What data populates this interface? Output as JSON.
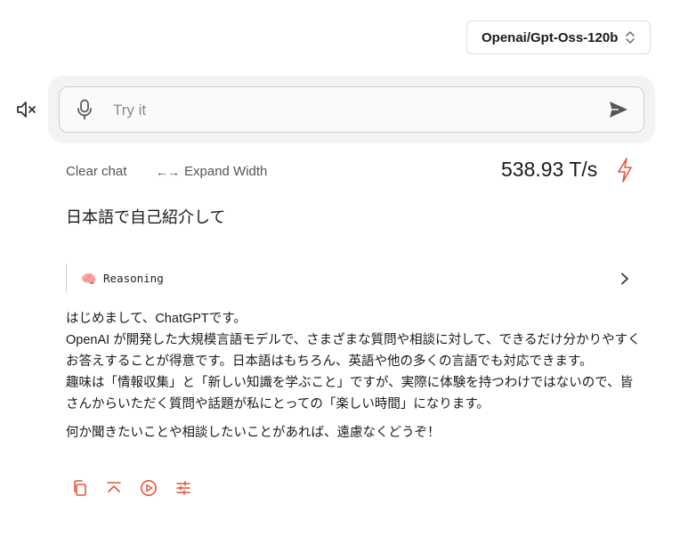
{
  "model_selector": {
    "value": "Openai/Gpt-Oss-120b"
  },
  "input": {
    "placeholder": "Try it",
    "value": ""
  },
  "toolbar": {
    "clear_chat": "Clear chat",
    "expand_width_arrows": "←→",
    "expand_width": "Expand Width",
    "speed": "538.93 T/s"
  },
  "chat": {
    "user_message": "日本語で自己紹介して",
    "reasoning_label": "Reasoning",
    "reasoning_emoji": "🧠",
    "answer_lines": [
      "はじめまして、ChatGPTです。",
      "OpenAI が開発した大規模言語モデルで、さまざまな質問や相談に対して、できるだけ分かりやすく",
      "お答えすることが得意です。日本語はもちろん、英語や他の多くの言語でも対応できます。",
      "趣味は「情報収集」と「新しい知識を学ぶこと」ですが、実際に体験を持つわけではないので、皆",
      "さんからいただく質問や話題が私にとっての「楽しい時間」になります。"
    ],
    "closing_line": "何か聞きたいことや相談したいことがあれば、遠慮なくどうぞ！"
  },
  "icons": {
    "mute": "speaker-muted-icon",
    "mic": "microphone-icon",
    "send": "send-icon",
    "bolt": "lightning-icon",
    "copy": "copy-icon",
    "collapse": "collapse-up-icon",
    "play": "play-circle-icon",
    "settings": "sliders-icon"
  },
  "colors": {
    "accent": "#e5533d",
    "input_bg": "#f3f3f3",
    "border": "#cfcfcf"
  }
}
